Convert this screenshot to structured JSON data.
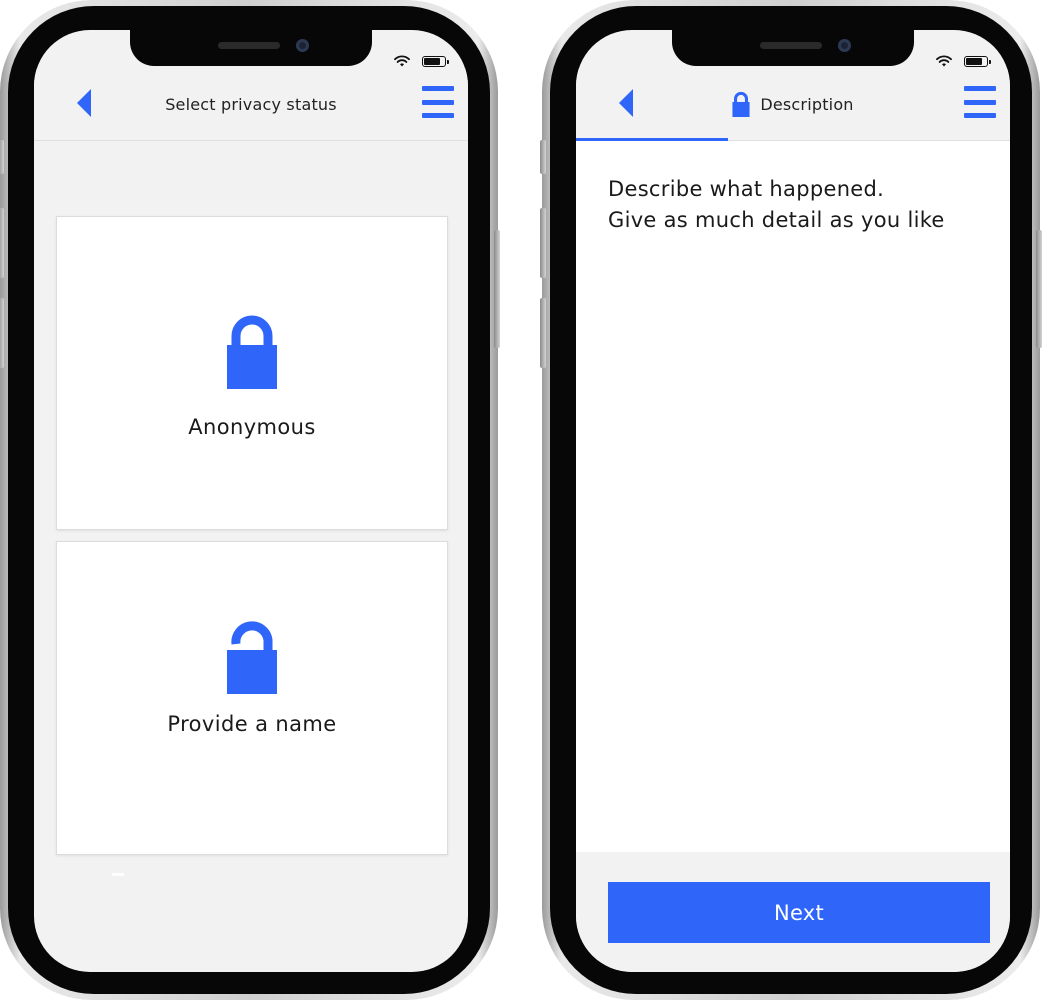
{
  "colors": {
    "accent": "#2f66f9",
    "screen_bg": "#f2f2f2",
    "card_bg": "#ffffff",
    "text": "#1a1a1a"
  },
  "left_screen": {
    "nav": {
      "back_icon": "chevron-left-icon",
      "title": "Select privacy status",
      "menu_icon": "hamburger-menu-icon"
    },
    "options": [
      {
        "label": "Anonymous",
        "icon": "lock-closed-icon"
      },
      {
        "label": "Provide a name",
        "icon": "lock-open-icon"
      }
    ]
  },
  "right_screen": {
    "nav": {
      "back_icon": "chevron-left-icon",
      "title_icon": "lock-closed-icon",
      "title": "Description",
      "menu_icon": "hamburger-menu-icon"
    },
    "progress_fraction": 0.35,
    "prompt_line1": "Describe what happened.",
    "prompt_line2": "Give as much detail as you like",
    "next_label": "Next"
  },
  "status_bar": {
    "wifi_icon": "wifi-icon",
    "battery_icon": "battery-icon",
    "battery_level": 0.8
  }
}
